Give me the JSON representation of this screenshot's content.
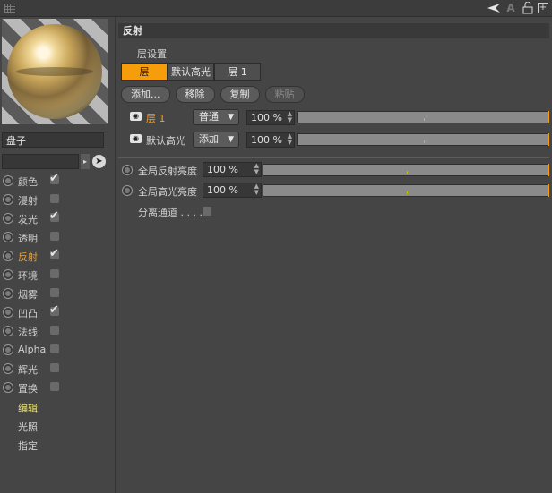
{
  "topbar": {
    "icons": [
      "grip-icon",
      "arrow-cursor-icon",
      "text-icon",
      "lock-icon",
      "add-icon"
    ]
  },
  "material": {
    "name": "盘子",
    "search_value": ""
  },
  "channels": [
    {
      "label": "颜色",
      "checked": true,
      "active": false
    },
    {
      "label": "漫射",
      "checked": false,
      "active": false
    },
    {
      "label": "发光",
      "checked": true,
      "active": false
    },
    {
      "label": "透明",
      "checked": false,
      "active": false
    },
    {
      "label": "反射",
      "checked": true,
      "active": true
    },
    {
      "label": "环境",
      "checked": false,
      "active": false
    },
    {
      "label": "烟雾",
      "checked": false,
      "active": false
    },
    {
      "label": "凹凸",
      "checked": true,
      "active": false
    },
    {
      "label": "法线",
      "checked": false,
      "active": false
    },
    {
      "label": "Alpha",
      "checked": false,
      "active": false
    },
    {
      "label": "辉光",
      "checked": false,
      "active": false
    },
    {
      "label": "置换",
      "checked": false,
      "active": false
    }
  ],
  "sub_items": [
    "编辑",
    "光照",
    "指定"
  ],
  "panel": {
    "title": "反射",
    "layer_settings_label": "层设置",
    "tabs": [
      "层",
      "默认高光",
      "层 1"
    ],
    "buttons": {
      "add": "添加...",
      "remove": "移除",
      "copy": "复制",
      "paste": "粘贴"
    },
    "layers": [
      {
        "name": "层 1",
        "mode": "普通",
        "value": "100 %",
        "active": true
      },
      {
        "name": "默认高光",
        "mode": "添加",
        "value": "100 %",
        "active": false
      }
    ],
    "global": [
      {
        "label": "全局反射亮度",
        "value": "100 %"
      },
      {
        "label": "全局高光亮度",
        "value": "100 %"
      }
    ],
    "separate_pass_label": "分离通道 . . . .",
    "separate_pass_checked": false
  },
  "colors": {
    "accent": "#f59d0b",
    "active_text": "#f0a02a",
    "sub_active_text": "#e9e27a"
  }
}
